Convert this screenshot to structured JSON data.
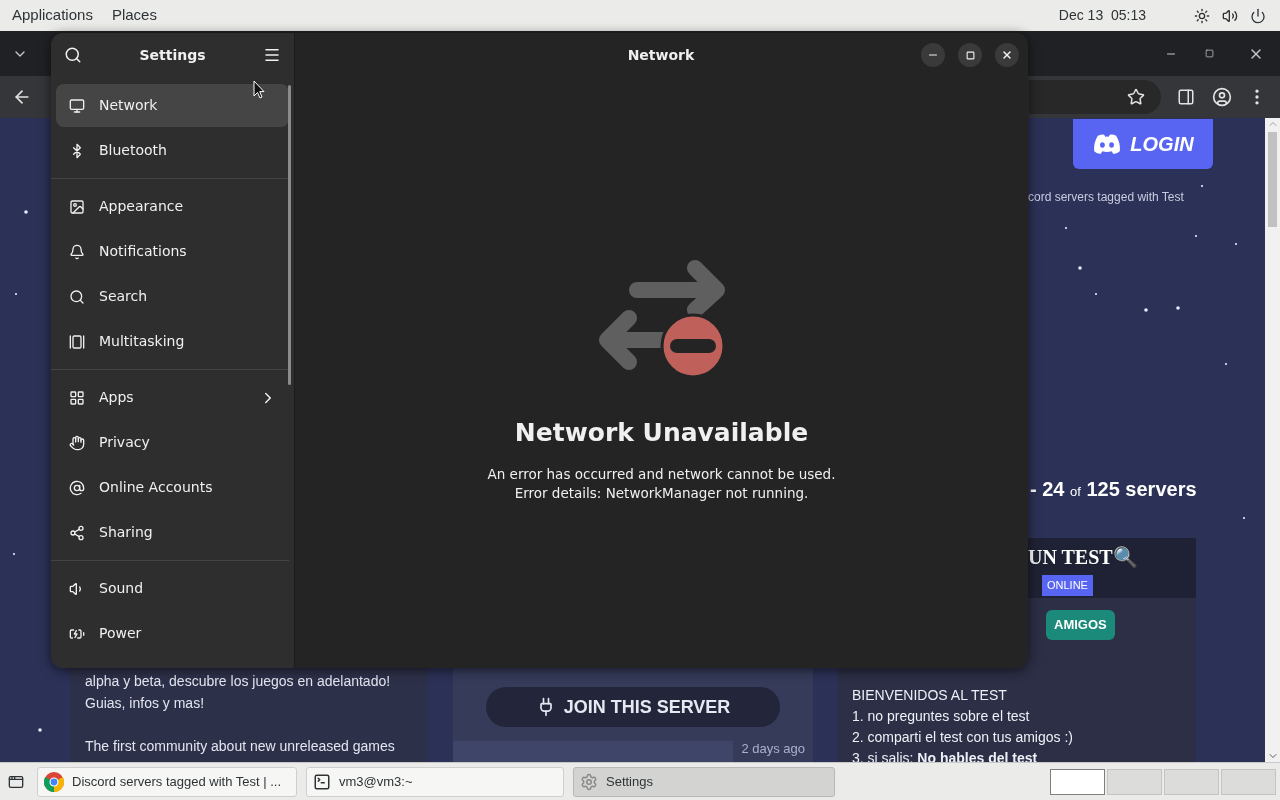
{
  "top_bar": {
    "menus": [
      "Applications",
      "Places"
    ],
    "clock": "Dec 13  05:13"
  },
  "browser": {
    "login_label": "LOGIN",
    "tagline": "cord servers tagged with Test",
    "servers_count": {
      "range": "- 24",
      "of": "of",
      "total": "125 servers"
    },
    "cards": [
      {
        "kind": "description",
        "paragraphs": [
          [
            "alpha y beta, descubre los juegos en adelantado!",
            "Guias, infos y mas!"
          ],
          [
            "The first community about new unreleased games"
          ]
        ]
      },
      {
        "kind": "join",
        "button": "JOIN THIS SERVER",
        "time": "2 days ago"
      },
      {
        "kind": "server",
        "title": "UN TEST🔍",
        "badge": "ONLINE",
        "tags": [
          "AMIGOS"
        ],
        "lines": [
          "BIENVENIDOS AL TEST",
          "1. no preguntes sobre el test",
          "2. comparti el test con tus amigos :)",
          "3. si salis: **No hables del test**"
        ]
      }
    ]
  },
  "settings": {
    "title": "Settings",
    "page_title": "Network",
    "groups": [
      [
        {
          "label": "Network",
          "kind": "page",
          "selected": true
        },
        {
          "label": "Bluetooth",
          "kind": "page",
          "selected": false
        }
      ],
      [
        {
          "label": "Appearance",
          "kind": "page",
          "selected": false
        },
        {
          "label": "Notifications",
          "kind": "page",
          "selected": false
        },
        {
          "label": "Search",
          "kind": "page",
          "selected": false
        },
        {
          "label": "Multitasking",
          "kind": "page",
          "selected": false
        }
      ],
      [
        {
          "label": "Apps",
          "kind": "submenu",
          "selected": false
        },
        {
          "label": "Privacy",
          "kind": "page",
          "selected": false
        },
        {
          "label": "Online Accounts",
          "kind": "page",
          "selected": false
        },
        {
          "label": "Sharing",
          "kind": "page",
          "selected": false
        }
      ],
      [
        {
          "label": "Sound",
          "kind": "page",
          "selected": false
        },
        {
          "label": "Power",
          "kind": "page",
          "selected": false
        }
      ]
    ],
    "status": {
      "title": "Network Unavailable",
      "lines": [
        "An error has occurred and network cannot be used.",
        "Error details: NetworkManager not running."
      ]
    }
  },
  "taskbar": {
    "tasks": [
      {
        "kind": "browser",
        "label": "Discord servers tagged with Test | ...",
        "selected": false
      },
      {
        "kind": "terminal",
        "label": "vm3@vm3:~",
        "selected": false
      },
      {
        "kind": "settings",
        "label": "Settings",
        "selected": true
      }
    ],
    "workspaces": [
      {
        "selected": true
      },
      {
        "selected": false
      },
      {
        "selected": false
      },
      {
        "selected": false
      }
    ]
  }
}
